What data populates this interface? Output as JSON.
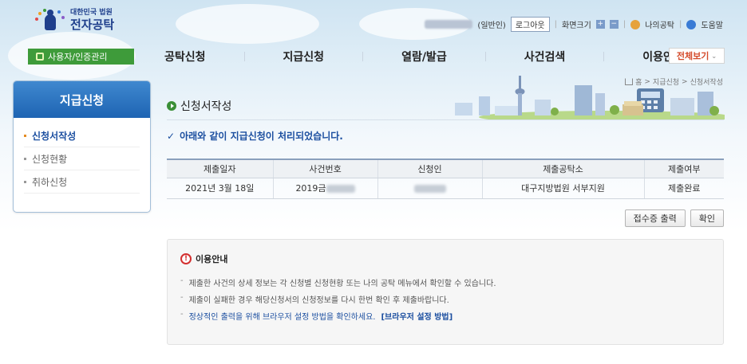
{
  "header": {
    "logo_sub": "대한민국 법원",
    "logo_main": "전자공탁",
    "user_type": "(일반인)",
    "logout_label": "로그아웃",
    "screen_size_label": "화면크기",
    "zoom_in": "+",
    "zoom_out": "−",
    "my_deposit_label": "나의공탁",
    "help_label": "도움말"
  },
  "nav": {
    "user_mgmt_label": "사용자/인증관리",
    "items": [
      "공탁신청",
      "지급신청",
      "열람/발급",
      "사건검색",
      "이용안내"
    ],
    "full_view_label": "전체보기"
  },
  "sidebar": {
    "title": "지급신청",
    "items": [
      {
        "label": "신청서작성",
        "active": true
      },
      {
        "label": "신청현황",
        "active": false
      },
      {
        "label": "취하신청",
        "active": false
      }
    ]
  },
  "breadcrumb": {
    "home": "홈",
    "sep1": ">",
    "level1": "지급신청",
    "sep2": ">",
    "level2": "신청서작성"
  },
  "page": {
    "title": "신청서작성",
    "done_message": "아래와 같이 지급신청이 처리되었습니다."
  },
  "table": {
    "headers": [
      "제출일자",
      "사건번호",
      "신청인",
      "제출공탁소",
      "제출여부"
    ],
    "rows": [
      {
        "date": "2021년 3월 18일",
        "case_no": "2019금",
        "applicant": "",
        "office": "대구지방법원 서부지원",
        "status": "제출완료"
      }
    ]
  },
  "actions": {
    "print_label": "접수증 출력",
    "confirm_label": "확인"
  },
  "info": {
    "title": "이용안내",
    "items": [
      "제출한 사건의 상세 정보는 각 신청별 신청현황 또는 나의 공탁 메뉴에서 확인할 수 있습니다.",
      "제출이 실패한 경우 해당신청서의 신청정보를 다시 한번 확인 후 제출바랍니다."
    ],
    "browser_note": "정상적인 출력을 위해 브라우저 설정 방법을 확인하세요.",
    "browser_link": "[브라우저 설정 방법]",
    "dash": "-"
  },
  "colors": {
    "brand_blue": "#1e64b3",
    "green_accent": "#3e9b3a",
    "link_blue": "#1c4fa0",
    "warn_red": "#d32f2f"
  }
}
